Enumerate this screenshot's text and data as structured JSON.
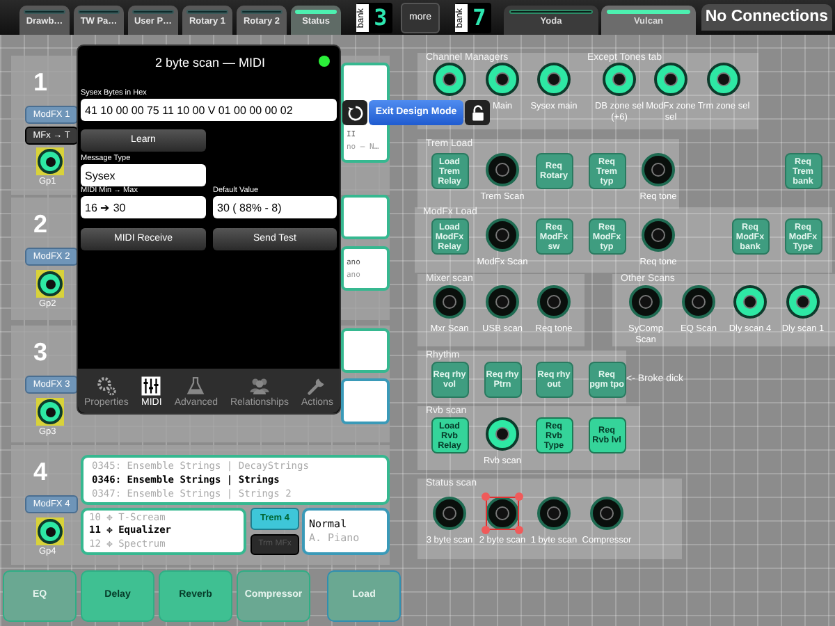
{
  "top_tabs": [
    {
      "label": "Drawb…",
      "selected": false
    },
    {
      "label": "TW Pa…",
      "selected": false
    },
    {
      "label": "User P…",
      "selected": false
    },
    {
      "label": "Rotary 1",
      "selected": false
    },
    {
      "label": "Rotary 2",
      "selected": false
    },
    {
      "label": "Status",
      "selected": true
    }
  ],
  "banks": [
    {
      "label": "bank",
      "value": "3"
    },
    {
      "label": "bank",
      "value": "7"
    }
  ],
  "more_button": "more",
  "scene_tabs": [
    {
      "label": "Yoda",
      "selected": false
    },
    {
      "label": "Vulcan",
      "selected": true
    }
  ],
  "connection_status": "No Connections",
  "lanes": [
    {
      "number": "1",
      "mod_button": "ModFX 1",
      "route_button": "MFx → T",
      "group": "Gp1",
      "card_lines": [
        "II",
        "no – N…"
      ]
    },
    {
      "number": "2",
      "mod_button": "ModFX 2",
      "group": "Gp2",
      "card_lines": [
        "ano",
        "ano"
      ]
    },
    {
      "number": "3",
      "mod_button": "ModFX 3",
      "group": "Gp3"
    },
    {
      "number": "4",
      "mod_button": "ModFX 4",
      "group": "Gp4",
      "patch_list": [
        {
          "text": "0345: Ensemble Strings | DecayStrings",
          "current": false
        },
        {
          "text": "0346: Ensemble Strings | Strings",
          "current": true
        },
        {
          "text": "0347: Ensemble Strings | Strings 2",
          "current": false
        }
      ],
      "effect_list": [
        {
          "text": "10 ✥ T-Scream",
          "current": false
        },
        {
          "text": "11 ✥ Equalizer",
          "current": true
        },
        {
          "text": "12 ✥ Spectrum",
          "current": false
        }
      ],
      "trem_button": "Trem 4",
      "mfx_button": "Trm MFx",
      "tone_lines": [
        "Normal",
        "A. Piano"
      ]
    }
  ],
  "popup": {
    "title": "2 byte scan — MIDI",
    "led_on": true,
    "sysex": {
      "label": "Sysex Bytes in Hex",
      "value": "41 10 00 00 75 11 10 00 V 01 00 00 00 02"
    },
    "learn_button": "Learn",
    "message_type": {
      "label": "Message Type",
      "value": "Sysex"
    },
    "midi_range": {
      "label": "MIDI Min → Max",
      "value": "16 ➔ 30"
    },
    "default_value": {
      "label": "Default Value",
      "value": "30 ( 88% - 8)"
    },
    "buttons": [
      "MIDI Receive",
      "Send Test"
    ],
    "tabs": [
      {
        "label": "Properties",
        "selected": false
      },
      {
        "label": "MIDI",
        "selected": true
      },
      {
        "label": "Advanced",
        "selected": false
      },
      {
        "label": "Relationships",
        "selected": false
      },
      {
        "label": "Actions",
        "selected": false
      }
    ]
  },
  "exit_design_button": "Exit Design Mode",
  "groups": [
    {
      "title": "Channel Managers",
      "items": [
        {
          "kind": "knob",
          "lit": true,
          "selected": false
        },
        {
          "kind": "knob",
          "label": "Main",
          "lit": true,
          "selected": false
        },
        {
          "kind": "knob",
          "label": "Sysex main",
          "lit": true,
          "selected": false
        }
      ]
    },
    {
      "title": "Except Tones tab",
      "items": [
        {
          "kind": "knob",
          "label": "DB zone sel (+6)",
          "lit": true,
          "selected": false
        },
        {
          "kind": "knob",
          "label": "ModFx zone sel",
          "lit": true,
          "selected": false
        },
        {
          "kind": "knob",
          "label": "Trm zone sel",
          "lit": true,
          "selected": false
        }
      ]
    },
    {
      "title": "Trem Load",
      "items": [
        {
          "kind": "button",
          "label": "Load Trem Relay",
          "lit": false,
          "selected": false
        },
        {
          "kind": "knob",
          "label": "Trem Scan",
          "lit": false,
          "selected": false
        },
        {
          "kind": "button",
          "label": "Req Rotary",
          "lit": false,
          "selected": false
        },
        {
          "kind": "button",
          "label": "Req Trem typ",
          "lit": false,
          "selected": false
        },
        {
          "kind": "knob",
          "label": "Req tone",
          "lit": false,
          "selected": false
        },
        {
          "kind": "button",
          "label": "Req Trem bank",
          "lit": false,
          "selected": false
        }
      ]
    },
    {
      "title": "ModFx Load",
      "items": [
        {
          "kind": "button",
          "label": "Load ModFx Relay",
          "lit": false,
          "selected": false
        },
        {
          "kind": "knob",
          "label": "ModFx Scan",
          "lit": false,
          "selected": false
        },
        {
          "kind": "button",
          "label": "Req ModFx sw",
          "lit": false,
          "selected": false
        },
        {
          "kind": "button",
          "label": "Req ModFx typ",
          "lit": false,
          "selected": false
        },
        {
          "kind": "knob",
          "label": "Req tone",
          "lit": false,
          "selected": false
        },
        {
          "kind": "button",
          "label": "Req ModFx bank",
          "lit": false,
          "selected": false
        },
        {
          "kind": "button",
          "label": "Req ModFx Type",
          "lit": false,
          "selected": false
        }
      ]
    },
    {
      "title": "Mixer scan",
      "items": [
        {
          "kind": "knob",
          "label": "Mxr Scan",
          "lit": false,
          "selected": false
        },
        {
          "kind": "knob",
          "label": "USB scan",
          "lit": false,
          "selected": false
        },
        {
          "kind": "knob",
          "label": "Req tone",
          "lit": false,
          "selected": false
        }
      ]
    },
    {
      "title": "Other Scans",
      "items": [
        {
          "kind": "knob",
          "label": "SyComp Scan",
          "lit": false,
          "selected": false
        },
        {
          "kind": "knob",
          "label": "EQ Scan",
          "lit": false,
          "selected": false
        },
        {
          "kind": "knob",
          "label": "Dly scan 4",
          "lit": true,
          "selected": false
        },
        {
          "kind": "knob",
          "label": "Dly scan 1",
          "lit": true,
          "selected": false
        }
      ]
    },
    {
      "title": "Rhythm",
      "note": "<- Broke dick",
      "items": [
        {
          "kind": "button",
          "label": "Req rhy vol",
          "lit": false,
          "selected": false
        },
        {
          "kind": "button",
          "label": "Req rhy Ptrn",
          "lit": false,
          "selected": false
        },
        {
          "kind": "button",
          "label": "Req rhy out",
          "lit": false,
          "selected": false
        },
        {
          "kind": "button",
          "label": "Req pgm tpo",
          "lit": false,
          "selected": false
        }
      ]
    },
    {
      "title": "Rvb scan",
      "items": [
        {
          "kind": "button",
          "label": "Load Rvb Relay",
          "lit": true,
          "selected": false
        },
        {
          "kind": "knob",
          "label": "Rvb scan",
          "lit": true,
          "selected": false
        },
        {
          "kind": "button",
          "label": "Req Rvb Type",
          "lit": true,
          "selected": false
        },
        {
          "kind": "button",
          "label": "Req Rvb lvl",
          "lit": true,
          "selected": false
        }
      ]
    },
    {
      "title": "Status scan",
      "items": [
        {
          "kind": "knob",
          "label": "3 byte scan",
          "lit": false,
          "selected": false
        },
        {
          "kind": "knob",
          "label": "2 byte scan",
          "lit": false,
          "selected": true
        },
        {
          "kind": "knob",
          "label": "1 byte scan",
          "lit": false,
          "selected": false
        },
        {
          "kind": "knob",
          "label": "Compressor",
          "lit": false,
          "selected": false
        }
      ]
    }
  ],
  "bottom_buttons": [
    {
      "label": "EQ",
      "lit": false
    },
    {
      "label": "Delay",
      "lit": true
    },
    {
      "label": "Reverb",
      "lit": true
    },
    {
      "label": "Compressor",
      "lit": false
    },
    {
      "label": "Load",
      "lit": false
    }
  ]
}
